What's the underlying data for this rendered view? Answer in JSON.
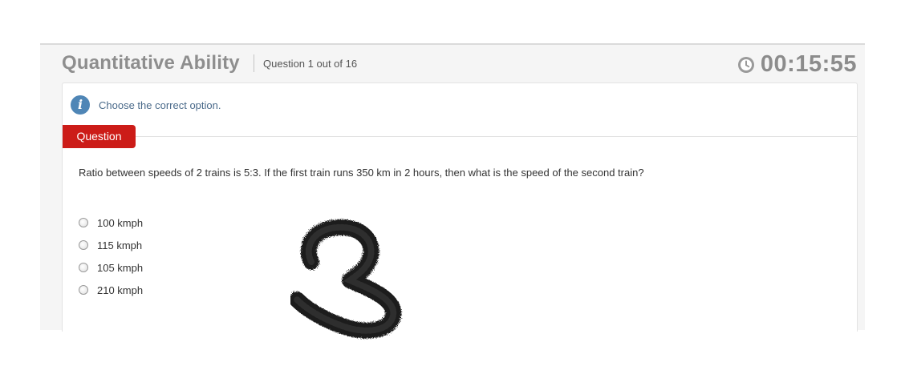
{
  "header": {
    "section_title": "Quantitative Ability",
    "question_counter": "Question 1 out of 16",
    "timer": "00:15:55",
    "timer_icon": "clock-icon"
  },
  "instruction": {
    "icon": "info-icon",
    "text": "Choose the correct option."
  },
  "question": {
    "tab_label": "Question",
    "text": "Ratio between speeds of 2 trains is 5:3. If the first train runs 350 km in 2 hours, then what is the speed of the second train?",
    "options": [
      {
        "label": "100 kmph",
        "selected": false
      },
      {
        "label": "115 kmph",
        "selected": false
      },
      {
        "label": "105 kmph",
        "selected": false
      },
      {
        "label": "210 kmph",
        "selected": false
      }
    ]
  },
  "colors": {
    "tab_red": "#cc1c18",
    "info_blue": "#4f86b6",
    "title_gray": "#8e8e8e"
  }
}
